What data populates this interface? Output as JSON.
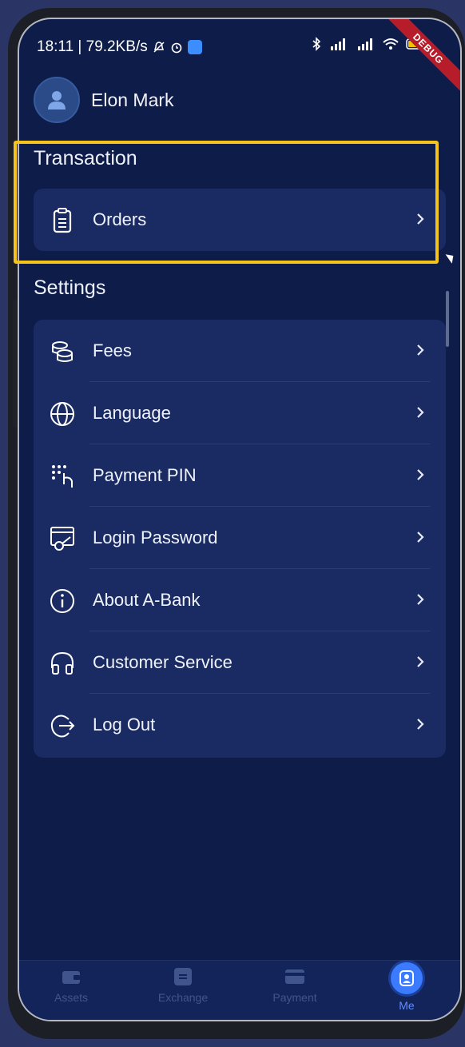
{
  "status_bar": {
    "time_speed": "18:11 | 79.2KB/s",
    "debug_banner": "DEBUG",
    "icons": [
      "mute-icon",
      "alarm-icon",
      "app-notification-icon",
      "bluetooth-icon",
      "signal-icon",
      "signal-icon",
      "wifi-icon",
      "battery-icon"
    ]
  },
  "profile": {
    "name": "Elon Mark",
    "avatar_icon": "user-icon"
  },
  "transaction": {
    "title": "Transaction",
    "items": [
      {
        "label": "Orders",
        "icon": "clipboard-icon"
      }
    ]
  },
  "settings": {
    "title": "Settings",
    "items": [
      {
        "label": "Fees",
        "icon": "coins-icon"
      },
      {
        "label": "Language",
        "icon": "globe-icon"
      },
      {
        "label": "Payment PIN",
        "icon": "keypad-icon"
      },
      {
        "label": "Login Password",
        "icon": "key-icon"
      },
      {
        "label": "About A-Bank",
        "icon": "info-icon"
      },
      {
        "label": "Customer Service",
        "icon": "headset-icon"
      },
      {
        "label": "Log Out",
        "icon": "logout-icon"
      }
    ]
  },
  "tabbar": {
    "tabs": [
      {
        "label": "Assets",
        "icon": "wallet-icon"
      },
      {
        "label": "Exchange",
        "icon": "exchange-icon"
      },
      {
        "label": "Payment",
        "icon": "card-icon"
      },
      {
        "label": "Me",
        "icon": "user-icon",
        "active": true
      }
    ]
  },
  "colors": {
    "background": "#0e1c4a",
    "card": "#1a2b63",
    "highlight": "#f6c21c",
    "accent": "#3b7bff"
  }
}
